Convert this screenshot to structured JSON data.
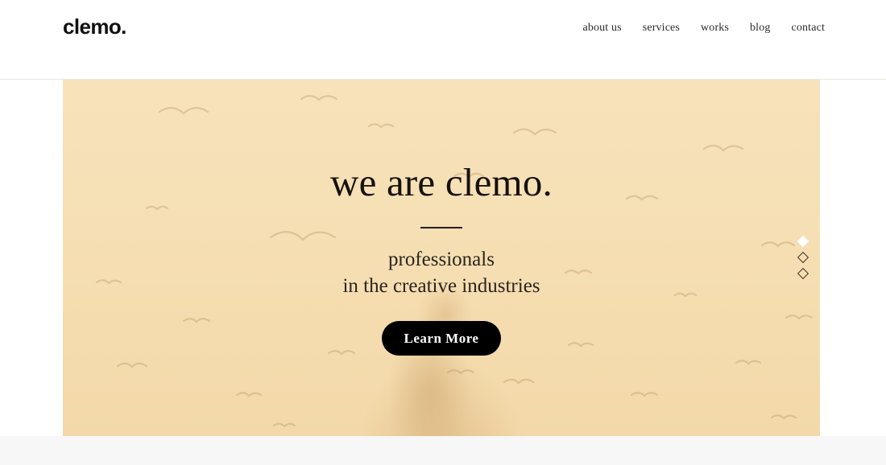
{
  "header": {
    "brand": "clemo.",
    "nav": [
      {
        "label": "about us",
        "name": "nav-link-about-us"
      },
      {
        "label": "services",
        "name": "nav-link-services"
      },
      {
        "label": "works",
        "name": "nav-link-works"
      },
      {
        "label": "blog",
        "name": "nav-link-blog"
      },
      {
        "label": "contact",
        "name": "nav-link-contact"
      }
    ]
  },
  "hero": {
    "title": "we are clemo.",
    "subtitle_line1": "professionals",
    "subtitle_line2": "in the creative industries",
    "cta_label": "Learn More",
    "background_color": "#f6dfb4",
    "background_motif": "flying-birds-silhouettes",
    "slider": {
      "total": 3,
      "active_index": 1,
      "dots": [
        {
          "label": "1",
          "state": "active"
        },
        {
          "label": "2",
          "state": "inactive"
        },
        {
          "label": "3",
          "state": "inactive"
        }
      ]
    }
  },
  "colors": {
    "hero_bg": "#f6dfb4",
    "cta_bg": "#000000",
    "cta_text": "#ffffff",
    "text_dark": "#16120c",
    "header_bg": "#ffffff",
    "next_section_bg": "#f7f7f7"
  }
}
